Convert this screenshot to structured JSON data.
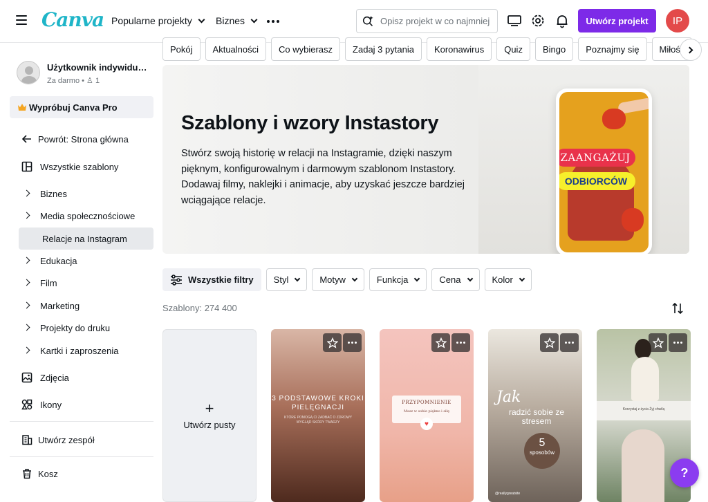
{
  "topbar": {
    "logo": "Canva",
    "nav": [
      "Popularne projekty",
      "Biznes"
    ],
    "search_placeholder": "Opisz projekt w co najmniej",
    "create_label": "Utwórz projekt",
    "avatar_initials": "IP"
  },
  "sidebar": {
    "user_name": "Użytkownik indywidual...",
    "user_plan": "Za darmo • ",
    "user_count": "1",
    "pro_label": "Wypróbuj Canva Pro",
    "back_label": "Powrót: Strona główna",
    "all_templates": "Wszystkie szablony",
    "categories": [
      "Biznes",
      "Media społecznościowe",
      "Relacje na Instagram",
      "Edukacja",
      "Film",
      "Marketing",
      "Projekty do druku",
      "Kartki i zaproszenia"
    ],
    "photos": "Zdjęcia",
    "icons": "Ikony",
    "team": "Utwórz zespół",
    "trash": "Kosz"
  },
  "chips": [
    "Pokój",
    "Aktualności",
    "Co wybierasz",
    "Zadaj 3 pytania",
    "Koronawirus",
    "Quiz",
    "Bingo",
    "Poznajmy się",
    "Miłość"
  ],
  "hero": {
    "title": "Szablony i wzory Instastory",
    "description": "Stwórz swoją historię w relacji na Instagramie, dzięki naszym pięknym, konfigurowalnym i darmowym szablonom Instastory. Dodawaj filmy, naklejki i animacje, aby uzyskać jeszcze bardziej wciągające relacje.",
    "tag1": "ZAANGAŻUJ",
    "tag2": "ODBIORCÓW"
  },
  "filters": {
    "all": "Wszystkie filtry",
    "items": [
      "Styl",
      "Motyw",
      "Funkcja",
      "Cena",
      "Kolor"
    ]
  },
  "count_label": "Szablony: 274 400",
  "blank_label": "Utwórz pusty",
  "cards": {
    "c1_title": "3 PODSTAWOWE KROKI PIELĘGNACJI",
    "c1_sub": "KTÓRE POMOGĄ CI ZADBAĆ O ZDROWY WYGLĄD SKÓRY TWARZY",
    "c2_title": "PRZYPOMNIENIE",
    "c2_sub": "Masz w sobie piękno i siłę",
    "c3_script": "Jak",
    "c3_text": "radzić sobie ze stresem",
    "c3_num": "5",
    "c3_num_label": "sposobów",
    "c3_handle": "@reallygreatsite",
    "c4_text": "Korzystaj z życia Żyj chwilą"
  },
  "help_label": "?"
}
